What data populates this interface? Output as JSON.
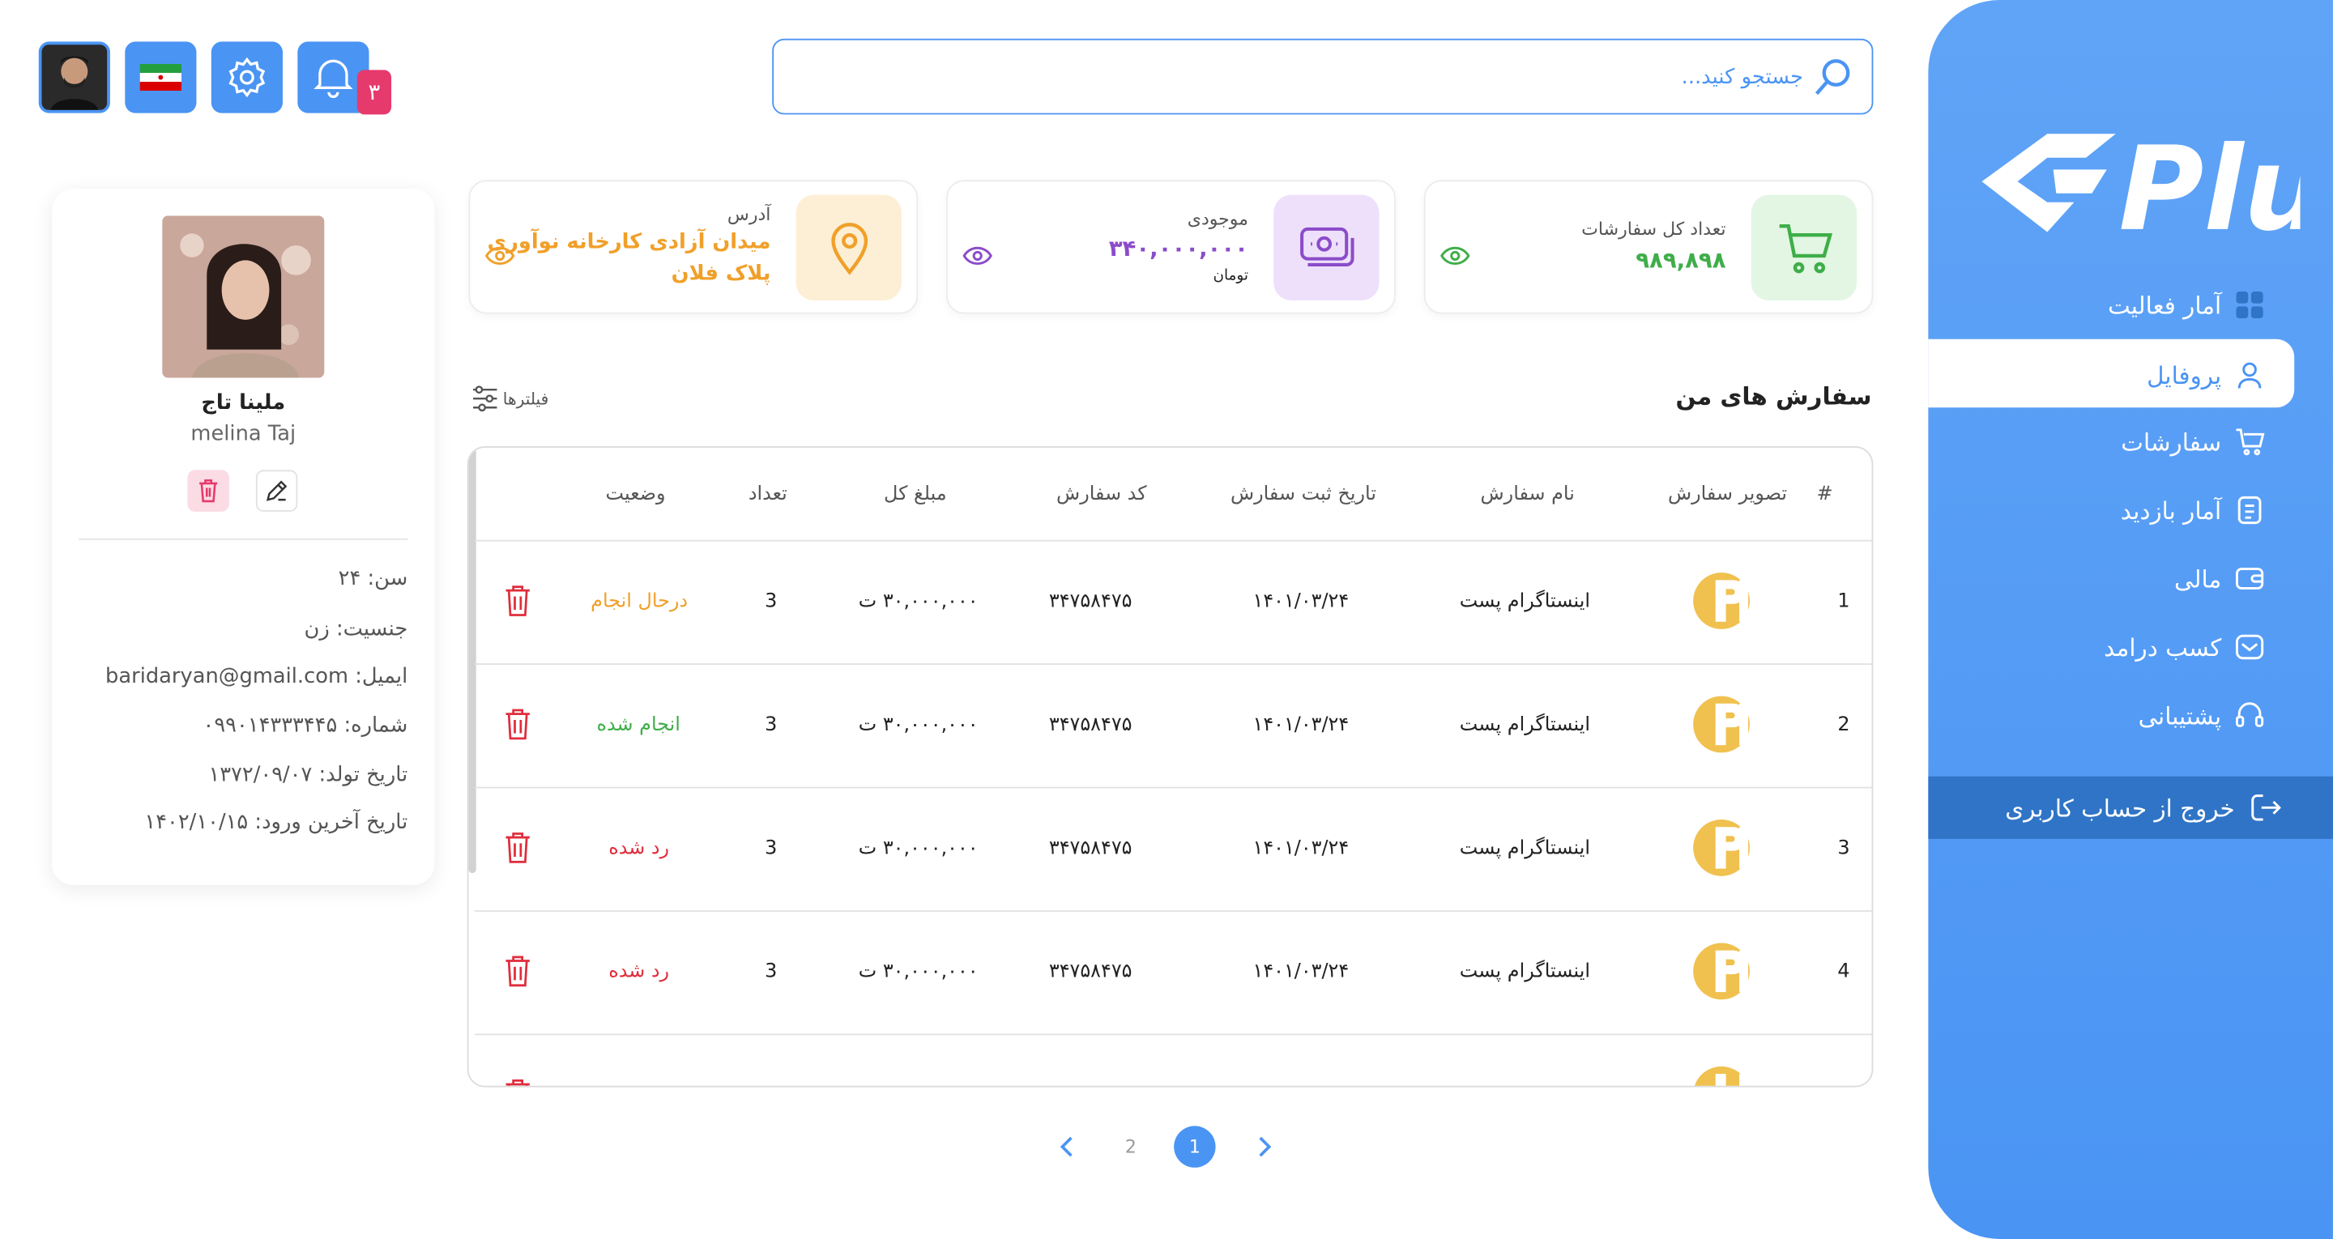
{
  "colors": {
    "accent": "#4a94f3",
    "green": "#3fae49",
    "purple": "#8b4cc9",
    "orange": "#f0a02a",
    "red": "#e02d3c",
    "badge": "#e63a6c"
  },
  "sidebar": {
    "logo": "Pluf",
    "items": [
      {
        "label": "آمار فعالیت",
        "icon": "grid-icon"
      },
      {
        "label": "پروفایل",
        "icon": "user-icon",
        "active": true
      },
      {
        "label": "سفارشات",
        "icon": "cart-icon"
      },
      {
        "label": "آمار بازدید",
        "icon": "document-icon"
      },
      {
        "label": "مالی",
        "icon": "wallet-icon"
      },
      {
        "label": "کسب درامد",
        "icon": "mail-icon"
      },
      {
        "label": "پشتیبانی",
        "icon": "headset-icon"
      }
    ],
    "logout": "خروج از حساب کاربری"
  },
  "header": {
    "search_placeholder": "جستجو کنید...",
    "notification_count": "۳"
  },
  "stats": [
    {
      "label": "تعداد کل سفارشات",
      "value": "۹۸۹,۸۹۸",
      "icon": "cart-icon"
    },
    {
      "label": "موجودی",
      "value": "۳۴۰,۰۰۰,۰۰۰",
      "unit": "تومان",
      "icon": "money-icon"
    },
    {
      "label": "آدرس",
      "line1": "میدان آزادی کارخانه نوآوری",
      "line2": "پلاک فلان",
      "icon": "location-pin-icon"
    }
  ],
  "profile": {
    "name_fa": "ملینا تاج",
    "name_en": "melina Taj",
    "age": "سن: ۲۴",
    "gender": "جنسیت: زن",
    "email": "ایمیل: baridaryan@gmail.com",
    "phone": "شماره: ۰۹۹۰۱۴۳۳۳۴۴۵",
    "birth": "تاریخ تولد: ۱۳۷۲/۰۹/۰۷",
    "last_login": "تاریخ آخرین ورود: ۱۴۰۲/۱۰/۱۵"
  },
  "orders": {
    "title": "سفارش های من",
    "filters_label": "فیلترها",
    "columns": [
      "#",
      "تصویر سفارش",
      "نام سفارش",
      "تاریخ ثبت سفارش",
      "کد سفارش",
      "مبلغ کل",
      "تعداد",
      "وضعیت"
    ],
    "rows": [
      {
        "num": "1",
        "name": "اینستاگرام پست",
        "date": "۱۴۰۱/۰۳/۲۴",
        "code": "۳۴۷۵۸۴۷۵",
        "amount": "۳۰,۰۰۰,۰۰۰ ت",
        "qty": "3",
        "status": "درحال انجام",
        "status_color": "#f0a02a"
      },
      {
        "num": "2",
        "name": "اینستاگرام پست",
        "date": "۱۴۰۱/۰۳/۲۴",
        "code": "۳۴۷۵۸۴۷۵",
        "amount": "۳۰,۰۰۰,۰۰۰ ت",
        "qty": "3",
        "status": "انجام شده",
        "status_color": "#3fae49"
      },
      {
        "num": "3",
        "name": "اینستاگرام پست",
        "date": "۱۴۰۱/۰۳/۲۴",
        "code": "۳۴۷۵۸۴۷۵",
        "amount": "۳۰,۰۰۰,۰۰۰ ت",
        "qty": "3",
        "status": "رد شده",
        "status_color": "#e02d3c"
      },
      {
        "num": "4",
        "name": "اینستاگرام پست",
        "date": "۱۴۰۱/۰۳/۲۴",
        "code": "۳۴۷۵۸۴۷۵",
        "amount": "۳۰,۰۰۰,۰۰۰ ت",
        "qty": "3",
        "status": "رد شده",
        "status_color": "#e02d3c"
      }
    ]
  },
  "pagination": {
    "pages": [
      "1",
      "2"
    ],
    "current": "1"
  }
}
